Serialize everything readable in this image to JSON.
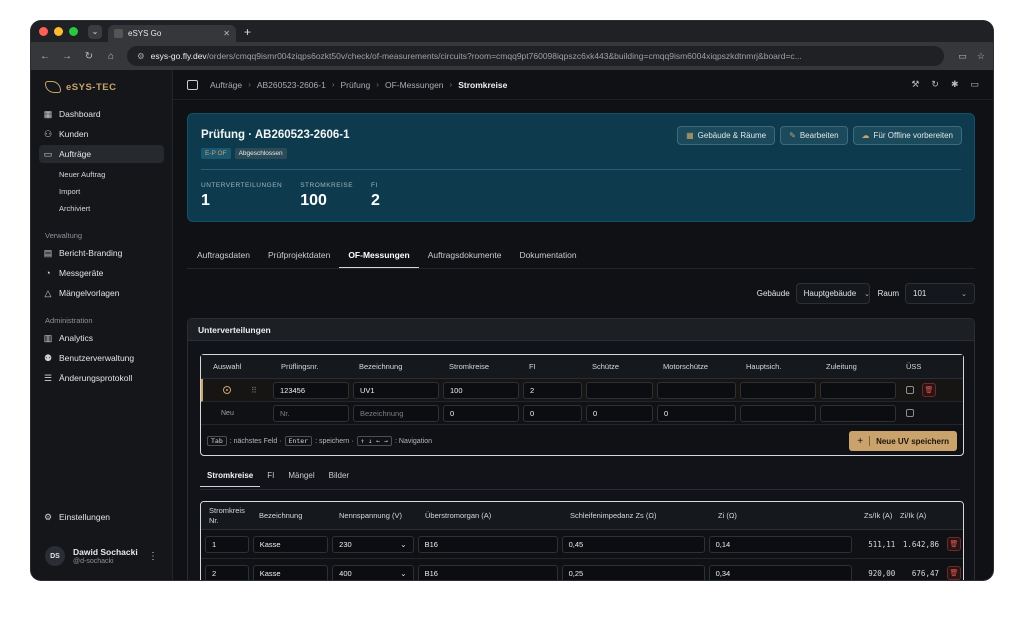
{
  "browser": {
    "tab_title": "eSYS Go",
    "url_host": "esys-go.fly.dev",
    "url_path": "/orders/cmqq9ismr004ziqps6ozkt50v/check/of-measurements/circuits?room=cmqq9pt760098iqpszc6xk443&building=cmqq9ism6004xiqpszkdtnmrj&board=c..."
  },
  "sidebar": {
    "brand": "eSYS-TEC",
    "items": [
      {
        "label": "Dashboard",
        "icon": "grid-icon"
      },
      {
        "label": "Kunden",
        "icon": "users-icon"
      },
      {
        "label": "Aufträge",
        "icon": "folder-icon"
      }
    ],
    "subitems": [
      "Neuer Auftrag",
      "Import",
      "Archiviert"
    ],
    "section_verwaltung": "Verwaltung",
    "verwaltung_items": [
      "Bericht-Branding",
      "Messgeräte",
      "Mängelvorlagen"
    ],
    "section_admin": "Administration",
    "admin_items": [
      "Analytics",
      "Benutzerverwaltung",
      "Änderungsprotokoll"
    ],
    "settings": "Einstellungen",
    "user": {
      "initials": "DS",
      "name": "Dawid Sochacki",
      "handle": "@d-sochacki"
    }
  },
  "breadcrumb": [
    "Aufträge",
    "AB260523-2606-1",
    "Prüfung",
    "OF-Messungen",
    "Stromkreise"
  ],
  "hero": {
    "title": "Prüfung · AB260523-2606-1",
    "badge_type": "E-P OF",
    "badge_status": "Abgeschlossen",
    "actions": [
      "Gebäude & Räume",
      "Bearbeiten",
      "Für Offline vorbereiten"
    ],
    "stats": [
      {
        "label": "UNTERVERTEILUNGEN",
        "value": "1"
      },
      {
        "label": "STROMKREISE",
        "value": "100"
      },
      {
        "label": "FI",
        "value": "2"
      }
    ]
  },
  "tabs": [
    "Auftragsdaten",
    "Prüfprojektdaten",
    "OF-Messungen",
    "Auftragsdokumente",
    "Dokumentation"
  ],
  "filters": {
    "building_label": "Gebäude",
    "building_value": "Hauptgebäude",
    "room_label": "Raum",
    "room_value": "101"
  },
  "uv_panel": {
    "title": "Unterverteilungen",
    "headers": [
      "Auswahl",
      "Prüflingsnr.",
      "Bezeichnung",
      "Stromkreise",
      "FI",
      "Schütze",
      "Motorschütze",
      "Hauptsich.",
      "Zuleitung",
      "ÜSS"
    ],
    "row": {
      "pruefling": "123456",
      "bezeichnung": "UV1",
      "stromkreise": "100",
      "fi": "2"
    },
    "new_row": {
      "label": "Neu",
      "pruefling_ph": "Nr.",
      "bezeichnung_ph": "Bezeichnung",
      "stromkreise": "0",
      "fi": "0",
      "schuetze": "0",
      "motorschuetze": "0"
    },
    "hint": {
      "tab": "Tab",
      "t1": ": nächstes Feld ·",
      "enter": "Enter",
      "t2": ": speichern ·",
      "arrows": "↑ ↓ ← →",
      "t3": ": Navigation"
    },
    "save_label": "Neue UV speichern"
  },
  "subtabs": [
    "Stromkreise",
    "FI",
    "Mängel",
    "Bilder"
  ],
  "circuits": {
    "headers": [
      "Stromkreis Nr.",
      "Bezeichnung",
      "Nennspannung (V)",
      "Überstromorgan (A)",
      "Schleifenimpedanz Zs (Ω)",
      "Zi (Ω)",
      "Zs/Ik (A)",
      "Zi/Ik (A)"
    ],
    "rows": [
      {
        "nr": "1",
        "bez": "Kasse",
        "spannung": "230",
        "organ": "B16",
        "zs": "0,45",
        "zi": "0,14",
        "zs_ik": "511,11",
        "zi_ik": "1.642,86"
      },
      {
        "nr": "2",
        "bez": "Kasse",
        "spannung": "400",
        "organ": "B16",
        "zs": "0,25",
        "zi": "0,34",
        "zs_ik": "920,00",
        "zi_ik": "676,47"
      }
    ]
  }
}
